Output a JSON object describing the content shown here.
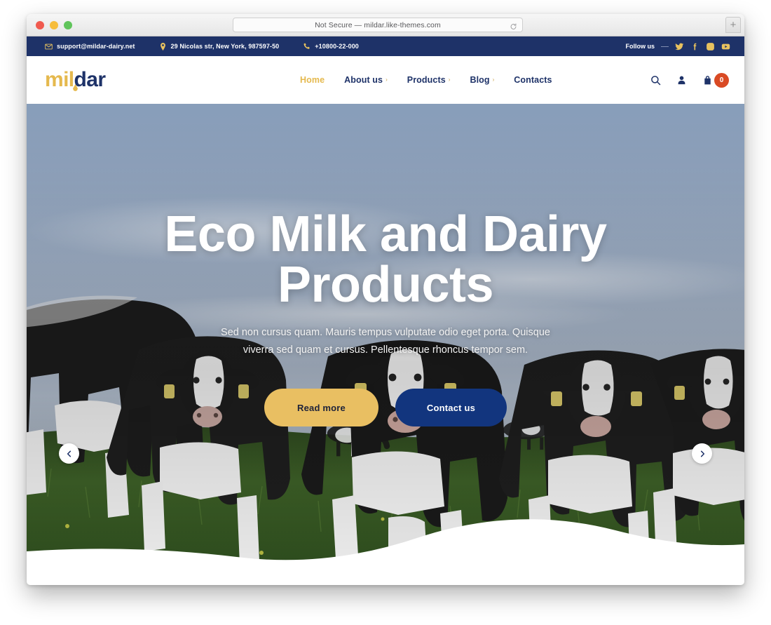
{
  "browser": {
    "url_text": "Not Secure — mildar.like-themes.com",
    "reload_label": "",
    "newtab_label": "+"
  },
  "topbar": {
    "email": "support@mildar-dairy.net",
    "address": "29 Nicolas str, New York, 987597-50",
    "phone": "+10800-22-000",
    "follow_label": "Follow us",
    "socials": [
      "twitter",
      "facebook",
      "instagram",
      "youtube"
    ]
  },
  "header": {
    "logo_first": "mil",
    "logo_second": "dar",
    "nav": [
      {
        "label": "Home",
        "caret": "",
        "active": true
      },
      {
        "label": "About us",
        "caret": "›",
        "active": false
      },
      {
        "label": "Products",
        "caret": "›",
        "active": false
      },
      {
        "label": "Blog",
        "caret": "›",
        "active": false
      },
      {
        "label": "Contacts",
        "caret": "",
        "active": false
      }
    ],
    "cart_count": "0"
  },
  "hero": {
    "title": "Eco Milk and Dairy Products",
    "subtitle": "Sed non cursus quam. Mauris tempus vulputate odio eget porta. Quisque viverra sed quam et cursus. Pellentesque rhoncus tempor sem.",
    "btn_read": "Read more",
    "btn_contact": "Contact us",
    "arrow_prev": "‹",
    "arrow_next": "›"
  },
  "colors": {
    "navy": "#1e3268",
    "gold": "#e5b94e",
    "button_gold": "#e9bf62",
    "button_navy": "#12357e",
    "cart_badge": "#d94a24"
  }
}
